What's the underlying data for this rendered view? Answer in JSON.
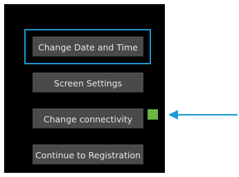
{
  "buttons": {
    "change_date_time": "Change Date and Time",
    "screen_settings": "Screen Settings",
    "change_connectivity": "Change connectivity",
    "continue_registration": "Continue to Registration"
  },
  "colors": {
    "focus": "#1b9ad6",
    "status_indicator": "#6ab542",
    "arrow": "#1b9ad6"
  }
}
